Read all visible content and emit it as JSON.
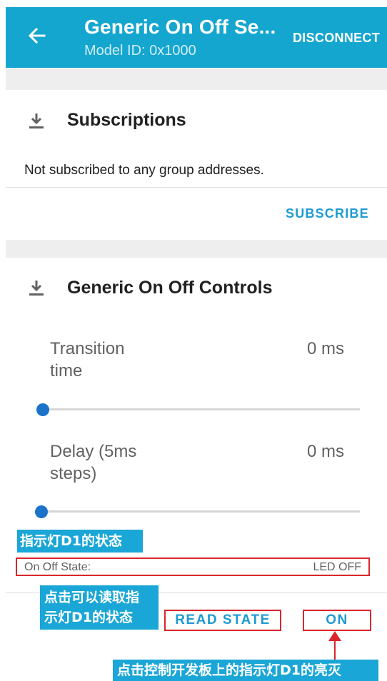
{
  "appbar": {
    "title": "Generic On Off Se...",
    "subtitle": "Model ID: 0x1000",
    "disconnect_label": "DISCONNECT",
    "background": "#15a6cf"
  },
  "subscriptions": {
    "icon": "download-icon",
    "title": "Subscriptions",
    "status_text": "Not subscribed to any group addresses.",
    "subscribe_label": "SUBSCRIBE"
  },
  "controls": {
    "icon": "download-icon",
    "title": "Generic On Off Controls",
    "transition_label": "Transition time",
    "transition_value": "0 ms",
    "transition_slider_value": 0,
    "delay_label": "Delay (5ms steps)",
    "delay_value": "0 ms",
    "delay_slider_value": 0,
    "state_label": "On Off State:",
    "state_value": "LED OFF",
    "read_state_label": "READ STATE",
    "on_label": "ON"
  },
  "annotations": {
    "led_state_note": "指示灯D1的状态",
    "read_state_note_line1": "点击可以读取指",
    "read_state_note_line2": "示灯D1的状态",
    "on_note": "点击控制开发板上的指示灯D1的亮灭",
    "callout_color": "#1aa6d6",
    "highlight_color": "#d9262c"
  }
}
